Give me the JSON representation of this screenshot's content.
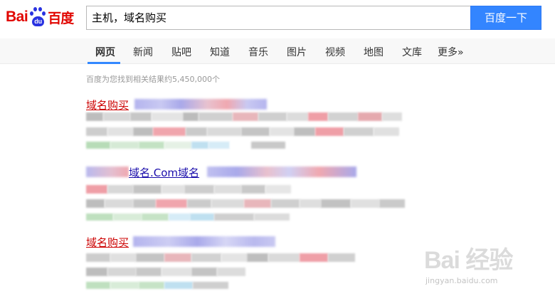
{
  "logo": {
    "latin": "Bai",
    "paw_text": "du",
    "chinese": "百度"
  },
  "search": {
    "query": "主机，域名购买",
    "button_label": "百度一下"
  },
  "tabs": [
    {
      "label": "网页",
      "active": true
    },
    {
      "label": "新闻"
    },
    {
      "label": "贴吧"
    },
    {
      "label": "知道"
    },
    {
      "label": "音乐"
    },
    {
      "label": "图片"
    },
    {
      "label": "视频"
    },
    {
      "label": "地图"
    },
    {
      "label": "文库"
    },
    {
      "label": "更多»"
    }
  ],
  "stats": "百度为您找到相关结果约5,450,000个",
  "results": [
    {
      "title_visible": "域名购买"
    },
    {
      "title_visible": "域名.Com域名"
    },
    {
      "title_visible": "域名购买"
    }
  ],
  "watermark": {
    "logo": "Bai 经验",
    "url": "jingyan.baidu.com"
  },
  "colors": {
    "brand_red": "#e10601",
    "brand_blue": "#2932e1",
    "button_blue": "#3385ff",
    "link_red": "#cc0000"
  }
}
